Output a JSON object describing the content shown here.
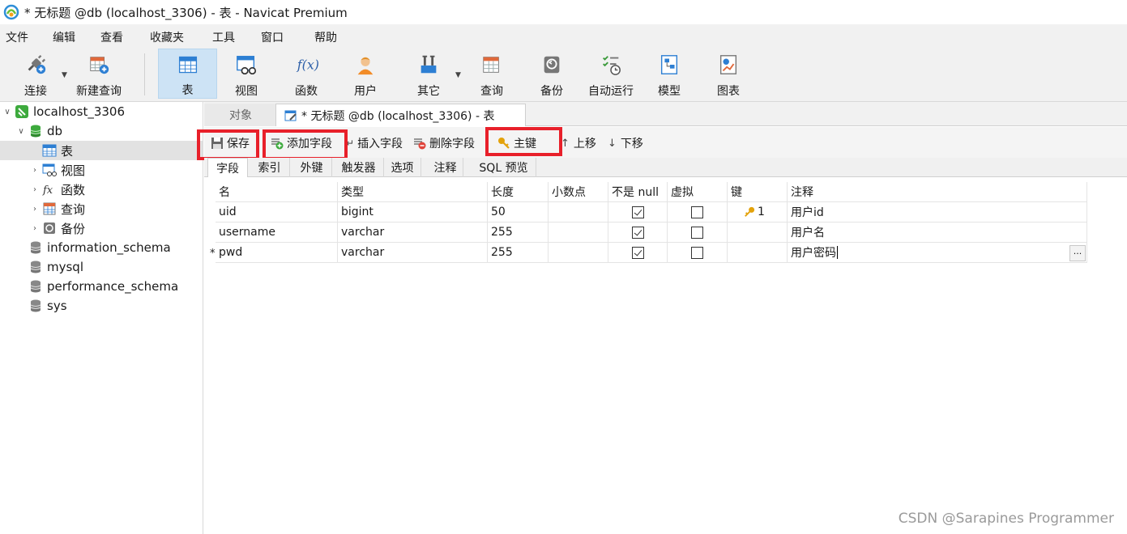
{
  "window": {
    "title": "* 无标题 @db (localhost_3306) - 表 - Navicat Premium"
  },
  "menu": [
    "文件",
    "编辑",
    "查看",
    "收藏夹",
    "工具",
    "窗口",
    "帮助"
  ],
  "toolbar": {
    "connect": "连接",
    "new_query": "新建查询",
    "table": "表",
    "view": "视图",
    "function": "函数",
    "user": "用户",
    "other": "其它",
    "query": "查询",
    "backup": "备份",
    "automation": "自动运行",
    "model": "模型",
    "chart": "图表",
    "active": "表"
  },
  "sidebar": {
    "connection": "localhost_3306",
    "database": "db",
    "items": [
      "表",
      "视图",
      "函数",
      "查询",
      "备份"
    ],
    "databases": [
      "information_schema",
      "mysql",
      "performance_schema",
      "sys"
    ]
  },
  "tabs": {
    "objects": "对象",
    "active": "* 无标题 @db (localhost_3306) - 表"
  },
  "designer_toolbar": {
    "save": "保存",
    "add_field": "添加字段",
    "insert_field": "插入字段",
    "delete_field": "删除字段",
    "primary_key": "主键",
    "move_up": "上移",
    "move_down": "下移"
  },
  "subtabs": [
    "字段",
    "索引",
    "外键",
    "触发器",
    "选项",
    "注释",
    "SQL 预览"
  ],
  "grid": {
    "columns": [
      "名",
      "类型",
      "长度",
      "小数点",
      "不是 null",
      "虚拟",
      "键",
      "注释"
    ],
    "rows": [
      {
        "name": "uid",
        "type": "bigint",
        "length": "50",
        "decimals": "",
        "not_null": true,
        "virtual": false,
        "key": "1",
        "comment": "用户id",
        "marker": ""
      },
      {
        "name": "username",
        "type": "varchar",
        "length": "255",
        "decimals": "",
        "not_null": true,
        "virtual": false,
        "key": "",
        "comment": "用户名",
        "marker": ""
      },
      {
        "name": "pwd",
        "type": "varchar",
        "length": "255",
        "decimals": "",
        "not_null": true,
        "virtual": false,
        "key": "",
        "comment": "用户密码",
        "marker": "*"
      }
    ],
    "ellipsis": "···"
  },
  "watermark": "CSDN @Sarapines Programmer",
  "colors": {
    "highlight_box": "#e8202a",
    "active_tool": "#cde3f5",
    "key_icon": "#e3a20b"
  }
}
